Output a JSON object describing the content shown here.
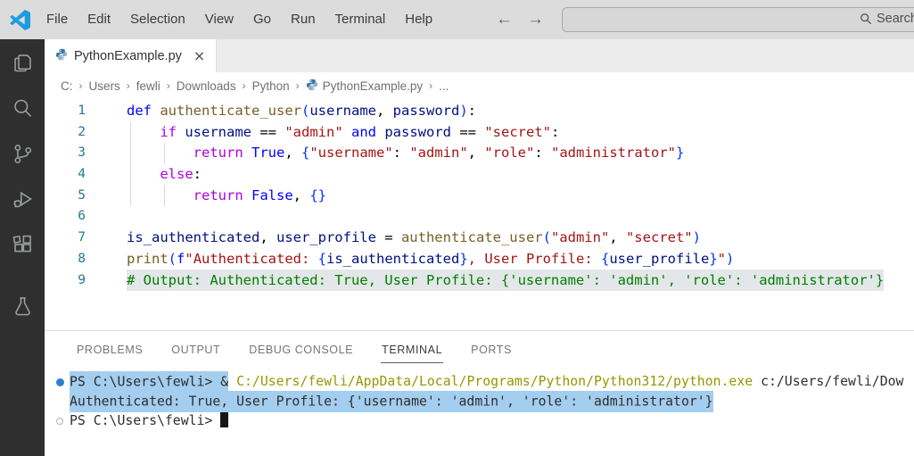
{
  "titlebar": {
    "menus": [
      "File",
      "Edit",
      "Selection",
      "View",
      "Go",
      "Run",
      "Terminal",
      "Help"
    ],
    "back_arrow": "←",
    "forward_arrow": "→",
    "search_placeholder": "Search"
  },
  "activitybar": {
    "icons": [
      "explorer",
      "search",
      "source-control",
      "run-debug",
      "extensions",
      "testing"
    ]
  },
  "tabbar": {
    "tab_label": "PythonExample.py",
    "close_glyph": "×"
  },
  "breadcrumb": {
    "items": [
      "C:",
      "Users",
      "fewli",
      "Downloads",
      "Python"
    ],
    "file": "PythonExample.py",
    "ellipsis": "...",
    "separator": "›"
  },
  "editor": {
    "lines": [
      {
        "num": "1",
        "guides": [],
        "tokens": [
          [
            "kw",
            "def"
          ],
          [
            "pl",
            " "
          ],
          [
            "fn",
            "authenticate_user"
          ],
          [
            "br",
            "("
          ],
          [
            "var",
            "username"
          ],
          [
            "pl",
            ", "
          ],
          [
            "var",
            "password"
          ],
          [
            "br",
            ")"
          ],
          [
            "pl",
            ":"
          ]
        ]
      },
      {
        "num": "2",
        "guides": [
          4
        ],
        "tokens": [
          [
            "pl",
            "    "
          ],
          [
            "ctrl",
            "if"
          ],
          [
            "pl",
            " "
          ],
          [
            "var",
            "username"
          ],
          [
            "pl",
            " == "
          ],
          [
            "str",
            "\"admin\""
          ],
          [
            "pl",
            " "
          ],
          [
            "kw",
            "and"
          ],
          [
            "pl",
            " "
          ],
          [
            "var",
            "password"
          ],
          [
            "pl",
            " == "
          ],
          [
            "str",
            "\"secret\""
          ],
          [
            "pl",
            ":"
          ]
        ]
      },
      {
        "num": "3",
        "guides": [
          4,
          42
        ],
        "tokens": [
          [
            "pl",
            "        "
          ],
          [
            "ctrl",
            "return"
          ],
          [
            "pl",
            " "
          ],
          [
            "kw",
            "True"
          ],
          [
            "pl",
            ", "
          ],
          [
            "br",
            "{"
          ],
          [
            "str",
            "\"username\""
          ],
          [
            "pl",
            ": "
          ],
          [
            "str",
            "\"admin\""
          ],
          [
            "pl",
            ", "
          ],
          [
            "str",
            "\"role\""
          ],
          [
            "pl",
            ": "
          ],
          [
            "str",
            "\"administrator\""
          ],
          [
            "br",
            "}"
          ]
        ]
      },
      {
        "num": "4",
        "guides": [
          4
        ],
        "tokens": [
          [
            "pl",
            "    "
          ],
          [
            "ctrl",
            "else"
          ],
          [
            "pl",
            ":"
          ]
        ]
      },
      {
        "num": "5",
        "guides": [
          4,
          42
        ],
        "tokens": [
          [
            "pl",
            "        "
          ],
          [
            "ctrl",
            "return"
          ],
          [
            "pl",
            " "
          ],
          [
            "kw",
            "False"
          ],
          [
            "pl",
            ", "
          ],
          [
            "br",
            "{}"
          ]
        ]
      },
      {
        "num": "6",
        "guides": [],
        "tokens": []
      },
      {
        "num": "7",
        "guides": [],
        "tokens": [
          [
            "var",
            "is_authenticated"
          ],
          [
            "pl",
            ", "
          ],
          [
            "var",
            "user_profile"
          ],
          [
            "pl",
            " = "
          ],
          [
            "fn",
            "authenticate_user"
          ],
          [
            "br",
            "("
          ],
          [
            "str",
            "\"admin\""
          ],
          [
            "pl",
            ", "
          ],
          [
            "str",
            "\"secret\""
          ],
          [
            "br",
            ")"
          ]
        ]
      },
      {
        "num": "8",
        "guides": [],
        "tokens": [
          [
            "fn",
            "print"
          ],
          [
            "br",
            "("
          ],
          [
            "kw",
            "f"
          ],
          [
            "str",
            "\"Authenticated: "
          ],
          [
            "br",
            "{"
          ],
          [
            "var",
            "is_authenticated"
          ],
          [
            "br",
            "}"
          ],
          [
            "str",
            ", User Profile: "
          ],
          [
            "br",
            "{"
          ],
          [
            "var",
            "user_profile"
          ],
          [
            "br",
            "}"
          ],
          [
            "str",
            "\""
          ],
          [
            "br",
            ")"
          ]
        ]
      },
      {
        "num": "9",
        "guides": [],
        "tokens": [
          [
            "cmt",
            "# Output: Authenticated: True, User Profile: {'username': 'admin', 'role': 'administrator'}",
            2
          ]
        ]
      }
    ]
  },
  "panel": {
    "tabs": [
      {
        "label": "PROBLEMS",
        "active": false
      },
      {
        "label": "OUTPUT",
        "active": false
      },
      {
        "label": "DEBUG CONSOLE",
        "active": false
      },
      {
        "label": "TERMINAL",
        "active": true
      },
      {
        "label": "PORTS",
        "active": false
      }
    ],
    "terminal": {
      "lines": [
        {
          "decoration": "dot",
          "tokens": [
            [
              "t",
              "PS C:\\Users\\fewli> &",
              1
            ],
            [
              "t",
              " "
            ],
            [
              "path",
              "C:/Users/fewli/AppData/Local/Programs/Python/Python312/python.exe"
            ],
            [
              "t",
              " c:/Users/fewli/Dow"
            ]
          ]
        },
        {
          "decoration": "",
          "tokens": [
            [
              "t",
              "Authenticated: True, User Profile: {'username': 'admin', 'role': 'administrator'}",
              1
            ]
          ]
        },
        {
          "decoration": "ring",
          "tokens": [
            [
              "t",
              "PS C:\\Users\\fewli> "
            ],
            [
              "cursor",
              ""
            ]
          ]
        }
      ]
    }
  },
  "colors": {
    "keyword": "#0000ff",
    "control": "#af00db",
    "string": "#a31515",
    "function": "#795e26",
    "variable": "#001080",
    "bracket": "#0431fa",
    "comment": "#008000",
    "line_number": "#237893",
    "terminal_path": "#949800",
    "terminal_selection": "#a4ceef",
    "editor_inactive_selection": "#e4e7e9",
    "command_dot": "#2b7fd4",
    "logo_blue": "#1d9ce0",
    "python_icon_blue": "#3876ab",
    "python_icon_gray": "#93aec7"
  }
}
